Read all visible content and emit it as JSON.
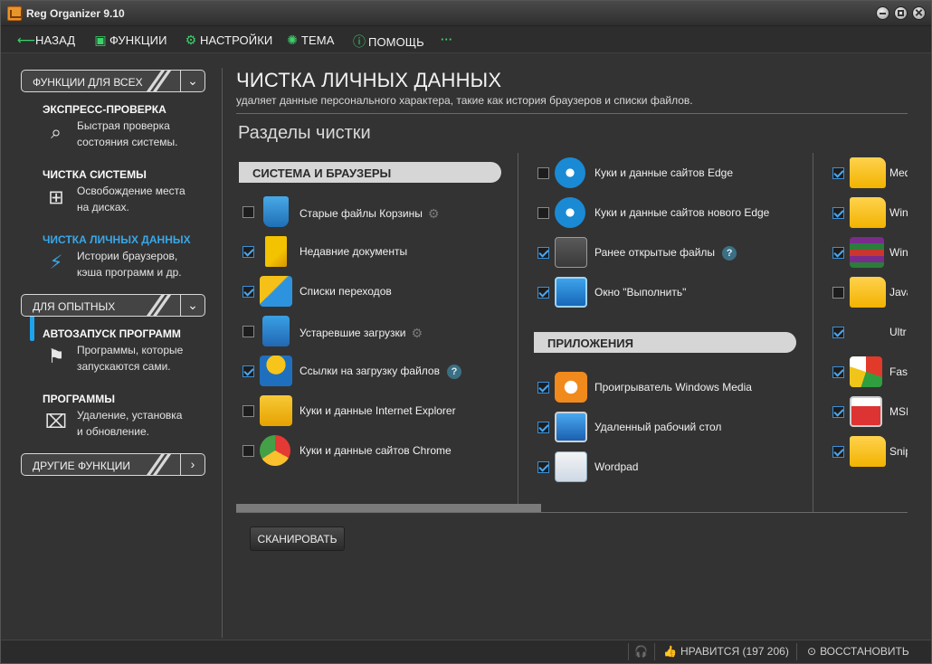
{
  "window": {
    "title": "Reg Organizer 9.10"
  },
  "toolbar": {
    "back": "НАЗАД",
    "functions": "ФУНКЦИИ",
    "settings": "НАСТРОЙКИ",
    "theme": "ТЕМА",
    "help": "ПОМОЩЬ",
    "more": "···"
  },
  "sidebar": {
    "group_all": "ФУНКЦИИ ДЛЯ ВСЕХ",
    "group_advanced": "ДЛЯ ОПЫТНЫХ",
    "group_other": "ДРУГИЕ ФУНКЦИИ",
    "items": [
      {
        "title": "ЭКСПРЕСС-ПРОВЕРКА",
        "line1": "Быстрая проверка",
        "line2": "состояния системы."
      },
      {
        "title": "ЧИСТКА СИСТЕМЫ",
        "line1": "Освобождение места",
        "line2": "на дисках."
      },
      {
        "title": "ЧИСТКА ЛИЧНЫХ ДАННЫХ",
        "line1": "Истории браузеров,",
        "line2": "кэша программ и др."
      },
      {
        "title": "АВТОЗАПУСК ПРОГРАММ",
        "line1": "Программы, которые",
        "line2": "запускаются сами."
      },
      {
        "title": "ПРОГРАММЫ",
        "line1": "Удаление, установка",
        "line2": "и обновление."
      }
    ]
  },
  "main": {
    "title": "ЧИСТКА ЛИЧНЫХ ДАННЫХ",
    "subtitle": "удаляет данные персонального характера, такие как история браузеров и списки файлов.",
    "section_title": "Разделы чистки",
    "cat_system": "СИСТЕМА И БРАУЗЕРЫ",
    "cat_apps": "ПРИЛОЖЕНИЯ",
    "col1": [
      {
        "label": "Старые файлы Корзины",
        "checked": false,
        "icon": "recycle-bin-icon"
      },
      {
        "label": "Недавние документы",
        "checked": true,
        "icon": "recent-documents-icon"
      },
      {
        "label": "Списки переходов",
        "checked": true,
        "icon": "jump-list-icon"
      },
      {
        "label": "Устаревшие загрузки",
        "checked": false,
        "icon": "downloads-icon"
      },
      {
        "label": "Ссылки на загрузку файлов",
        "checked": true,
        "icon": "download-links-icon"
      },
      {
        "label": "Куки и данные Internet Explorer",
        "checked": false,
        "icon": "internet-explorer-icon"
      },
      {
        "label": "Куки и данные сайтов Chrome",
        "checked": false,
        "icon": "chrome-icon"
      }
    ],
    "col2": [
      {
        "label": "Куки и данные сайтов Edge",
        "checked": false,
        "icon": "edge-icon"
      },
      {
        "label": "Куки и данные сайтов нового Edge",
        "checked": false,
        "icon": "new-edge-icon"
      },
      {
        "label": "Ранее открытые файлы",
        "checked": true,
        "icon": "recent-files-icon"
      },
      {
        "label": "Окно \"Выполнить\"",
        "checked": true,
        "icon": "run-window-icon"
      }
    ],
    "col2_apps": [
      {
        "label": "Проигрыватель Windows Media",
        "checked": true,
        "icon": "windows-media-player-icon"
      },
      {
        "label": "Удаленный рабочий стол",
        "checked": true,
        "icon": "remote-desktop-icon"
      },
      {
        "label": "Wordpad",
        "checked": true,
        "icon": "wordpad-icon"
      }
    ],
    "col3": [
      {
        "label": "Med",
        "checked": true,
        "icon": "folder-icon"
      },
      {
        "label": "Win",
        "checked": true,
        "icon": "folder-icon"
      },
      {
        "label": "Win",
        "checked": true,
        "icon": "winrar-icon"
      },
      {
        "label": "Java",
        "checked": false,
        "icon": "folder-icon"
      },
      {
        "label": "Ultr",
        "checked": true,
        "icon": "blank-icon"
      },
      {
        "label": "Fast",
        "checked": true,
        "icon": "faststone-icon"
      },
      {
        "label": "MSI",
        "checked": true,
        "icon": "msi-icon"
      },
      {
        "label": "Snip",
        "checked": true,
        "icon": "folder-icon"
      }
    ],
    "scan_button": "СКАНИРОВАТЬ"
  },
  "statusbar": {
    "likes": "НРАВИТСЯ (197 206)",
    "restore": "ВОССТАНОВИТЬ"
  },
  "colors": {
    "accent": "#1ea4ec",
    "green": "#3cd16b",
    "check": "#4aa7f0"
  }
}
